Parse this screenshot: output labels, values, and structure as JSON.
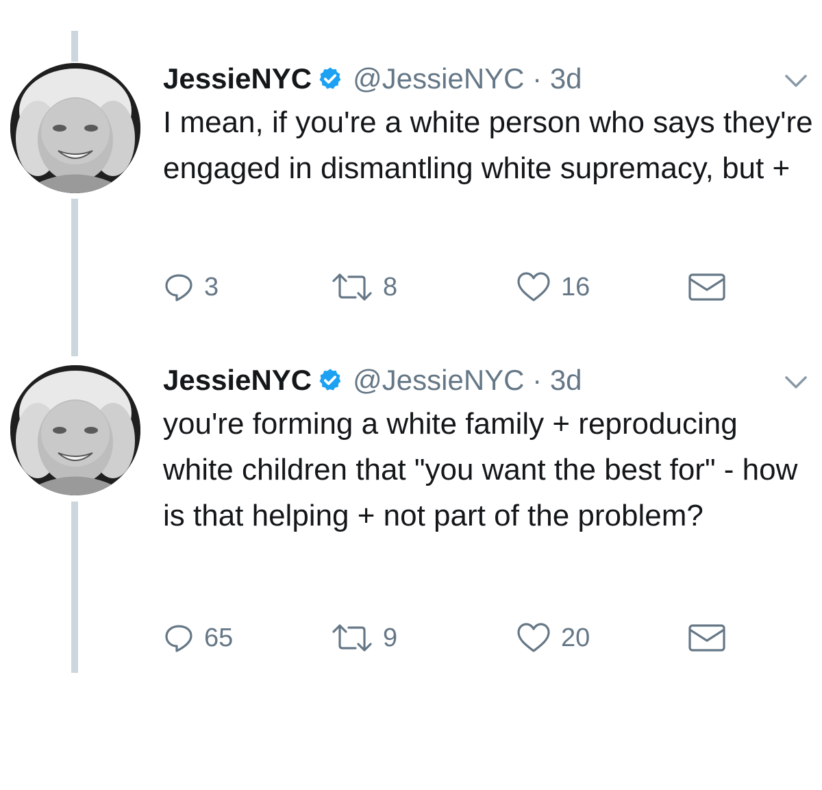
{
  "tweets": [
    {
      "display_name": "JessieNYC",
      "handle": "@JessieNYC",
      "time_sep": " · ",
      "time": "3d",
      "text": "I mean, if you're a white person who says they're engaged in dismantling white supremacy, but +",
      "replies": "3",
      "retweets": "8",
      "likes": "16"
    },
    {
      "display_name": "JessieNYC",
      "handle": "@JessieNYC",
      "time_sep": " · ",
      "time": "3d",
      "text": "you're forming a white family + reproducing white children that \"you want the best for\" - how is that helping + not part of the problem?",
      "replies": "65",
      "retweets": "9",
      "likes": "20"
    }
  ],
  "icons": {
    "verified": "verified-badge-icon",
    "caret": "chevron-down-icon",
    "reply": "reply-icon",
    "retweet": "retweet-icon",
    "like": "heart-icon",
    "message": "envelope-icon"
  },
  "colors": {
    "verified_blue": "#1da1f2",
    "meta_gray": "#657786",
    "thread_line": "#ccd6dd",
    "text": "#14171a"
  }
}
